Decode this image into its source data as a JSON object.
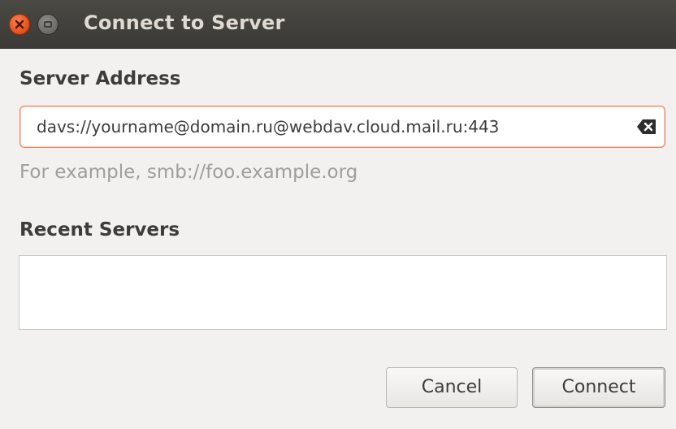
{
  "window": {
    "title": "Connect to Server"
  },
  "server_address": {
    "heading": "Server Address",
    "value": "davs://yourname@domain.ru@webdav.cloud.mail.ru:443",
    "hint": "For example, smb://foo.example.org"
  },
  "recent_servers": {
    "heading": "Recent Servers",
    "items": []
  },
  "buttons": {
    "cancel_label": "Cancel",
    "connect_label": "Connect"
  },
  "colors": {
    "titlebar": "#3c3b37",
    "close_button": "#e9541e",
    "field_focus_border": "#e9855a",
    "hint_text": "#a09e99"
  }
}
